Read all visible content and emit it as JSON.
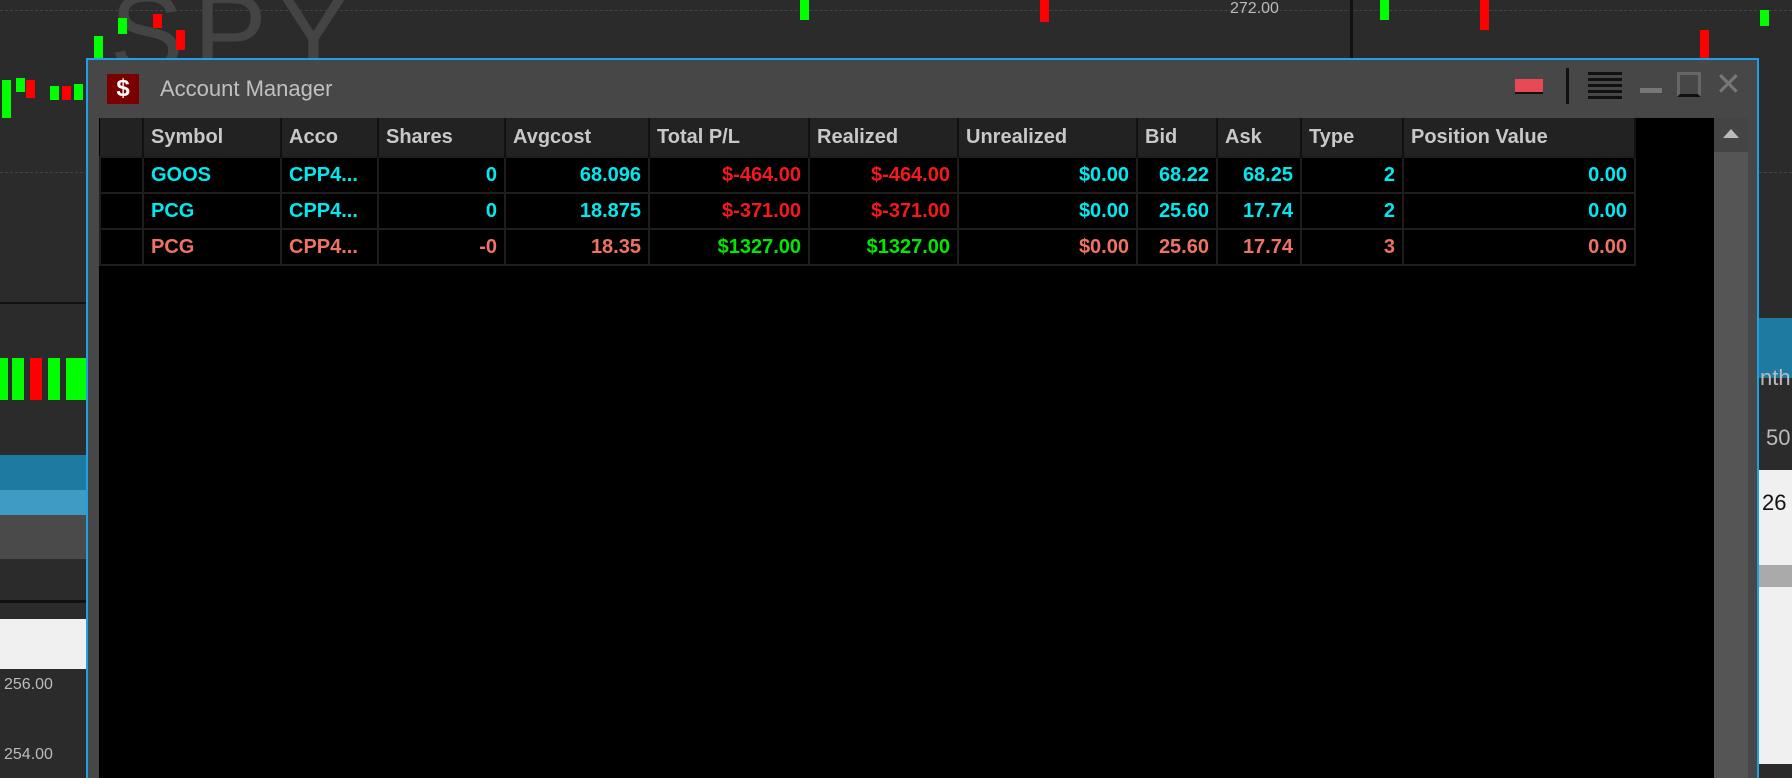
{
  "background": {
    "watermark": "SPY",
    "prices": [
      "272.00",
      "256.00",
      "254.00"
    ],
    "right_labels": [
      "nth",
      "50",
      "26"
    ]
  },
  "window": {
    "title": "Account Manager",
    "icon": "dollar-icon",
    "icon_glyph": "$",
    "columns": [
      "",
      "Symbol",
      "Acco",
      "Shares",
      "Avgcost",
      "Total P/L",
      "Realized",
      "Unrealized",
      "Bid",
      "Ask",
      "Type",
      "Position Value"
    ],
    "rows": [
      {
        "symbol": "GOOS",
        "account": "CPP4...",
        "shares": "0",
        "avgcost": "68.096",
        "total_pl": "$-464.00",
        "realized": "$-464.00",
        "unrealized": "$0.00",
        "bid": "68.22",
        "ask": "68.25",
        "type": "2",
        "position_value": "0.00",
        "color": "#00e8f0",
        "pl_color": "#f4191a"
      },
      {
        "symbol": "PCG",
        "account": "CPP4...",
        "shares": "0",
        "avgcost": "18.875",
        "total_pl": "$-371.00",
        "realized": "$-371.00",
        "unrealized": "$0.00",
        "bid": "25.60",
        "ask": "17.74",
        "type": "2",
        "position_value": "0.00",
        "color": "#00e8f0",
        "pl_color": "#f4191a"
      },
      {
        "symbol": "PCG",
        "account": "CPP4...",
        "shares": "-0",
        "avgcost": "18.35",
        "total_pl": "$1327.00",
        "realized": "$1327.00",
        "unrealized": "$0.00",
        "bid": "25.60",
        "ask": "17.74",
        "type": "3",
        "position_value": "0.00",
        "color": "#f07264",
        "pl_color": "#00e800"
      }
    ]
  }
}
